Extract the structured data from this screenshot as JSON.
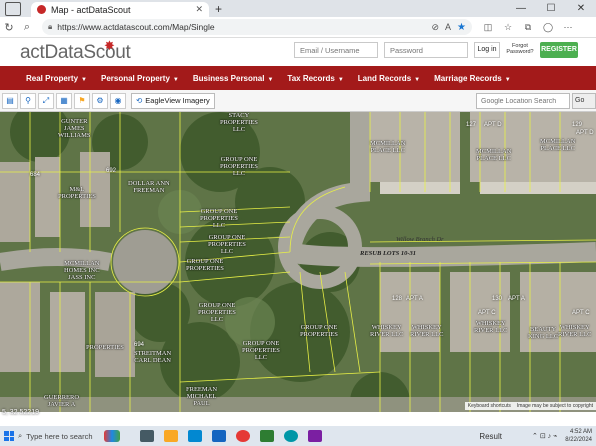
{
  "browser": {
    "tab_title": "Map - actDataScout",
    "tab_close": "✕",
    "new_tab": "+",
    "url": "https://www.actdatascout.com/Map/Single",
    "window_controls": [
      "—",
      "☐",
      "✕"
    ]
  },
  "site": {
    "logo": "actDataScout",
    "email_placeholder": "Email / Username",
    "password_placeholder": "Password",
    "login_label": "Log in",
    "forgot_label": "Forgot Password?",
    "register_label": "REGISTER"
  },
  "nav": {
    "items": [
      {
        "label": "Real Property"
      },
      {
        "label": "Personal Property"
      },
      {
        "label": "Business Personal"
      },
      {
        "label": "Tax Records"
      },
      {
        "label": "Land Records"
      },
      {
        "label": "Marriage Records"
      }
    ]
  },
  "map_toolbar": {
    "eagleview_label": "EagleView Imagery",
    "search_placeholder": "Google Location Search",
    "go_label": "Go"
  },
  "map": {
    "parcel_labels": [
      {
        "text": "GUNTER\nJAMES\nWILLIAMS"
      },
      {
        "text": "STACY\nPROPERTIES\nLLC"
      },
      {
        "text": "GROUP ONE\nPROPERTIES\nLLC"
      },
      {
        "text": "DOLLAR ANN\nFREEMAN"
      },
      {
        "text": "M&L\nPROPERTIES"
      },
      {
        "text": "GROUP ONE\nPROPERTIES\nLLC"
      },
      {
        "text": "GROUP ONE\nPROPERTIES\nLLC"
      },
      {
        "text": "GROUP ONE\nPROPERTIES"
      },
      {
        "text": "MCMILLAN\nHOMES INC\nJASS INC"
      },
      {
        "text": "GROUP ONE\nPROPERTIES\nLLC"
      },
      {
        "text": "PROPERTIES"
      },
      {
        "text": "STREITMAN\nCARL DEAN"
      },
      {
        "text": "GROUP ONE\nPROPERTIES\nLLC"
      },
      {
        "text": "FREEMAN\nMICHAEL\nPAUL"
      },
      {
        "text": "GUERRERO\nJAVIER A"
      },
      {
        "text": "MCMILLAN\nPLACE LLC"
      },
      {
        "text": "MCMILLAN\nPLACE LLC"
      },
      {
        "text": "MCMILLAN\nPLACE LLC"
      },
      {
        "text": "WHISKEY\nRIVER LLC"
      },
      {
        "text": "WHISKEY\nRIVER LLC"
      },
      {
        "text": "WHISKEY\nRIVER LLC"
      },
      {
        "text": "BEAUTY\nKING LLC"
      },
      {
        "text": "WHISKEY\nRIVER LLC"
      },
      {
        "text": "GROUP ONE\nPROPERTIES"
      }
    ],
    "numbers": [
      "684",
      "692",
      "694",
      "127",
      "APT D",
      "129",
      "APT D",
      "128",
      "APT A",
      "130",
      "APT A",
      "APT C",
      "APT C"
    ],
    "street_labels": [
      "Willow Branch Dr",
      "RESUB LOTS 10-31"
    ],
    "coordinate": "5, 32.52219",
    "attribution": [
      "Keyboard shortcuts",
      "Image may be subject to copyright"
    ]
  },
  "taskbar": {
    "search_placeholder": "Type here to search",
    "result_label": "Result",
    "time": "4:52 AM",
    "date": "8/22/2024"
  }
}
